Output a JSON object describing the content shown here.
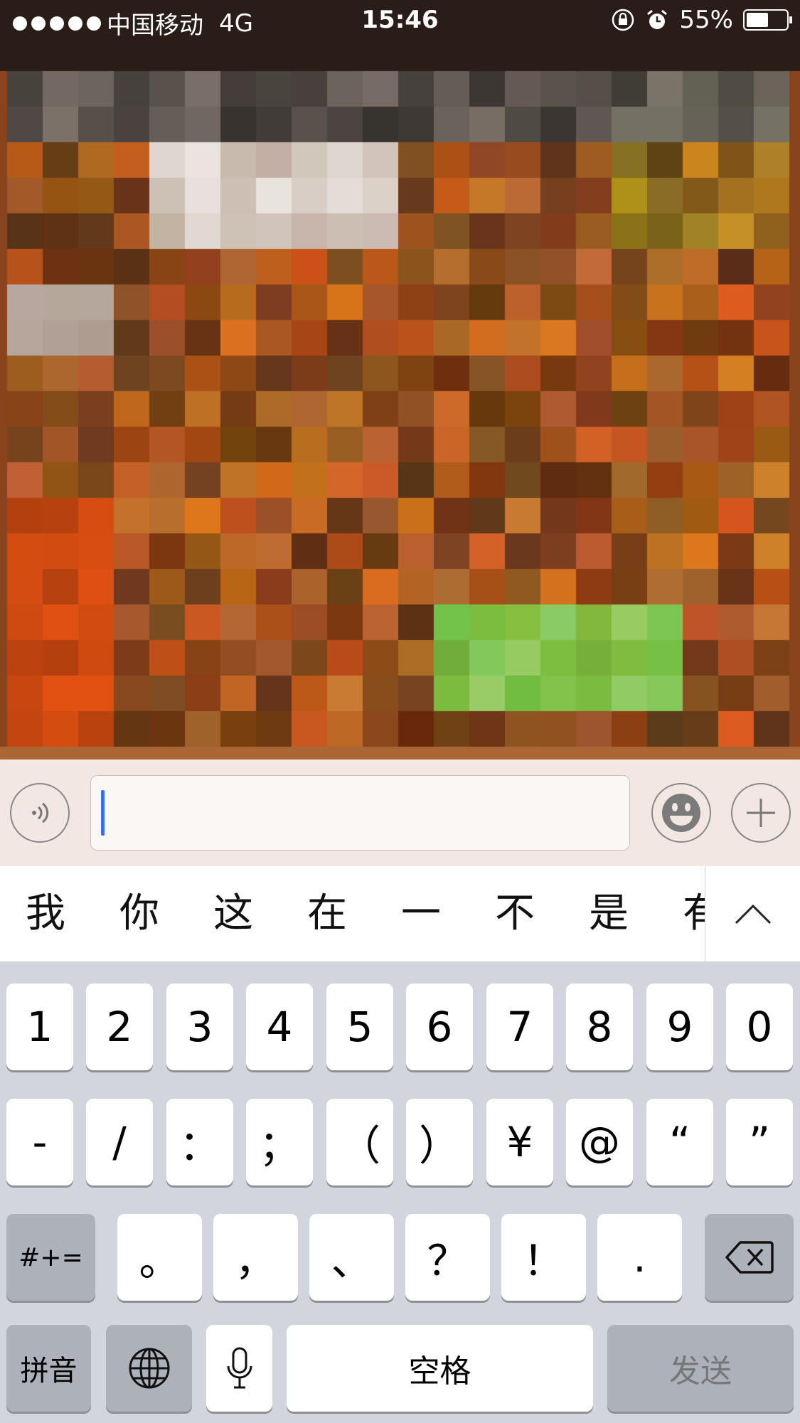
{
  "status_bar": {
    "carrier": "中国移动",
    "network": "4G",
    "time": "15:46",
    "battery": "55%",
    "battery_level": 0.55,
    "icons": [
      "signal-dots-icon",
      "orientation-lock-icon",
      "alarm-icon",
      "battery-icon"
    ]
  },
  "input_bar": {
    "voice_icon": "voice-icon",
    "emoji_icon": "emoji-icon",
    "plus_icon": "plus-icon",
    "text_value": ""
  },
  "candidates": [
    "我",
    "你",
    "这",
    "在",
    "一",
    "不",
    "是",
    "有"
  ],
  "keyboard": {
    "row1": [
      "1",
      "2",
      "3",
      "4",
      "5",
      "6",
      "7",
      "8",
      "9",
      "0"
    ],
    "row2": [
      "-",
      "/",
      "：",
      "；",
      "（",
      "）",
      "¥",
      "@",
      "“",
      "”"
    ],
    "row3_mode": "#+=",
    "row3": [
      "。",
      "，",
      "、",
      "？",
      "！",
      "."
    ],
    "backspace_icon": "backspace-icon",
    "pinyin": "拼音",
    "globe_icon": "globe-icon",
    "mic_icon": "mic-icon",
    "space": "空格",
    "send": "发送"
  },
  "colors": {
    "cursor": "#3a6ff2",
    "keyboard_bg": "#d2d5db",
    "key_bg": "#ffffff",
    "key_dark_bg": "#acb1ba"
  }
}
